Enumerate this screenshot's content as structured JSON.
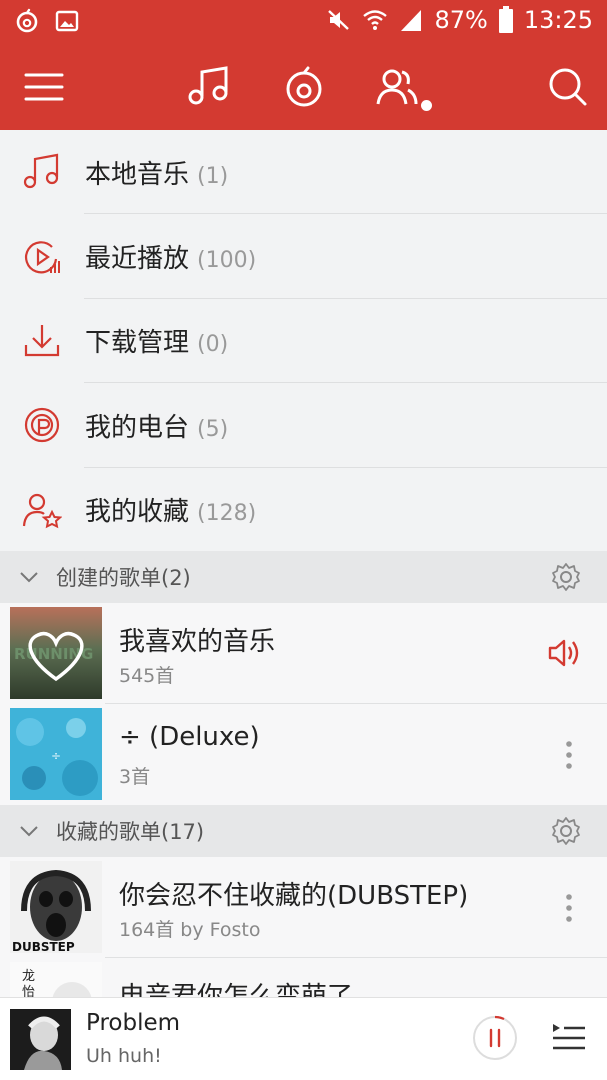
{
  "status_bar": {
    "battery": "87%",
    "time": "13:25",
    "icons": [
      "netease-music-icon",
      "gallery-icon",
      "mute-icon",
      "wifi-icon",
      "signal-icon",
      "battery-icon"
    ]
  },
  "header": {
    "icons": [
      "menu-icon",
      "music-note-icon",
      "netease-logo-icon",
      "friends-icon",
      "search-icon"
    ]
  },
  "menu": {
    "items": [
      {
        "label": "本地音乐",
        "count": "(1)",
        "icon": "music-note-icon"
      },
      {
        "label": "最近播放",
        "count": "(100)",
        "icon": "recent-play-icon"
      },
      {
        "label": "下载管理",
        "count": "(0)",
        "icon": "download-icon"
      },
      {
        "label": "我的电台",
        "count": "(5)",
        "icon": "radio-icon"
      },
      {
        "label": "我的收藏",
        "count": "(128)",
        "icon": "collect-icon"
      }
    ]
  },
  "created_section": {
    "title": "创建的歌单(2)",
    "playlists": [
      {
        "title": "我喜欢的音乐",
        "subtitle": "545首",
        "cover_text": "RUNNING"
      },
      {
        "title": "÷ (Deluxe)",
        "subtitle": "3首"
      }
    ]
  },
  "collected_section": {
    "title": "收藏的歌单(17)",
    "playlists": [
      {
        "title": "你会忍不住收藏的(DUBSTEP)",
        "subtitle": "164首 by Fosto",
        "cover_text": "DUBSTEP"
      },
      {
        "title": "电音君你怎么变萌了",
        "cover_text": "龙\n怡"
      }
    ]
  },
  "player": {
    "title": "Problem",
    "subtitle": "Uh huh!"
  },
  "colors": {
    "brand_red": "#d33a31",
    "background": "#f2f3f4",
    "section_bg": "#e6e7e8"
  }
}
